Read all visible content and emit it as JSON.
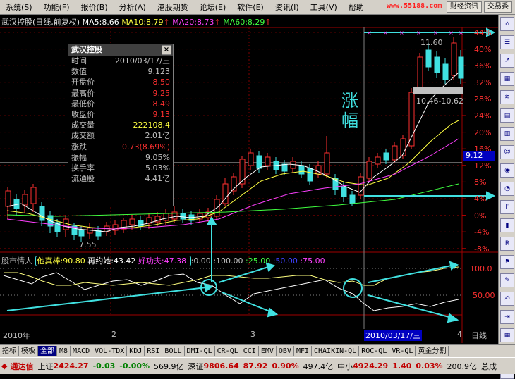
{
  "menu": {
    "items": [
      "系统(S)",
      "功能(F)",
      "报价(B)",
      "分析(A)",
      "港股期货",
      "论坛(E)",
      "软件(E)",
      "资讯(I)",
      "工具(V)",
      "帮助"
    ],
    "btn_finance": "财经资讯",
    "btn_trade": "交易委",
    "watermark": "www.55188.com"
  },
  "chart_header": {
    "stock": "武汉控股(日线,前复权)",
    "ma5": "MA5:8.66",
    "ma10": "MA10:8.79",
    "ma20": "MA20:8.73",
    "ma60": "MA60:8.29",
    "arrow": "↑"
  },
  "info_panel": {
    "title": "武汉控股",
    "close": "×",
    "rows": [
      {
        "label": "时间",
        "value": "2010/03/17/三"
      },
      {
        "label": "数值",
        "value": "9.123"
      },
      {
        "label": "开盘价",
        "value": "8.50"
      },
      {
        "label": "最高价",
        "value": "9.25"
      },
      {
        "label": "最低价",
        "value": "8.49"
      },
      {
        "label": "收盘价",
        "value": "9.13"
      },
      {
        "label": "成交量",
        "value": "222108.4"
      },
      {
        "label": "成交额",
        "value": "2.01亿"
      },
      {
        "label": "涨跌",
        "value": "0.73(8.69%)"
      },
      {
        "label": "振幅",
        "value": "9.05%"
      },
      {
        "label": "换手率",
        "value": "5.03%"
      },
      {
        "label": "流通股",
        "value": "4.41亿"
      }
    ]
  },
  "annotations": {
    "zhangfu": "涨幅",
    "price_low": "7.55",
    "price_high": "11.60",
    "range": "10.46-10.62",
    "current": "9.12"
  },
  "price_axis": [
    "44%",
    "40%",
    "36%",
    "32%",
    "28%",
    "24%",
    "20%",
    "16%",
    "12%",
    "8%",
    "4%",
    "0%",
    "-4%",
    "-8%"
  ],
  "indicator": {
    "name": "股市情人",
    "v1": "他真棒:90.80",
    "v2": "再约她:43.42",
    "v3": "好功夫:47.38",
    "lv1": ":0.00",
    "lv2": ":100.00",
    "lv3": ":25.00",
    "lv4": ":50.00",
    "lv5": ":75.00",
    "axis_top": "100.0",
    "axis_mid": "50.00"
  },
  "date_axis": {
    "start": "2010年",
    "m2": "2",
    "m3": "3",
    "cursor": "2010/03/17/三",
    "m4": "4",
    "period": "日线"
  },
  "bottom_tabs": [
    "指标",
    "模板",
    "全部",
    "M8",
    "MACD",
    "VOL-TDX",
    "KDJ",
    "RSI",
    "BOLL",
    "DMI-QL",
    "CR-QL",
    "CCI",
    "EMV",
    "OBV",
    "MFI",
    "CHAIKIN-QL",
    "ROC-QL",
    "VR-QL",
    "黄金分割"
  ],
  "status": {
    "app": "通达信",
    "sh_label": "上证",
    "sh_val": "2424.27",
    "sh_chg": "-0.03",
    "sh_pct": "-0.00%",
    "sh_amt": "569.9亿",
    "sz_label": "深证",
    "sz_val": "9806.64",
    "sz_chg": "87.92",
    "sz_pct": "0.90%",
    "sz_amt": "497.4亿",
    "zx_label": "中小",
    "zx_val": "4924.29",
    "zx_chg": "1.40",
    "zx_pct": "0.03%",
    "zx_amt": "200.9亿",
    "tail": "总成"
  },
  "right_toolbar": [
    "home-icon",
    "list-icon",
    "trend-icon",
    "chart-icon",
    "lines-icon",
    "doc-icon",
    "table-icon",
    "people-icon",
    "globe-icon",
    "gauge-icon",
    "f10-icon",
    "bar-icon",
    "rsi-icon",
    "flag-icon",
    "tool-icon",
    "pen-icon",
    "exit-icon",
    "grid-icon",
    "down-icon",
    "link-icon"
  ]
}
